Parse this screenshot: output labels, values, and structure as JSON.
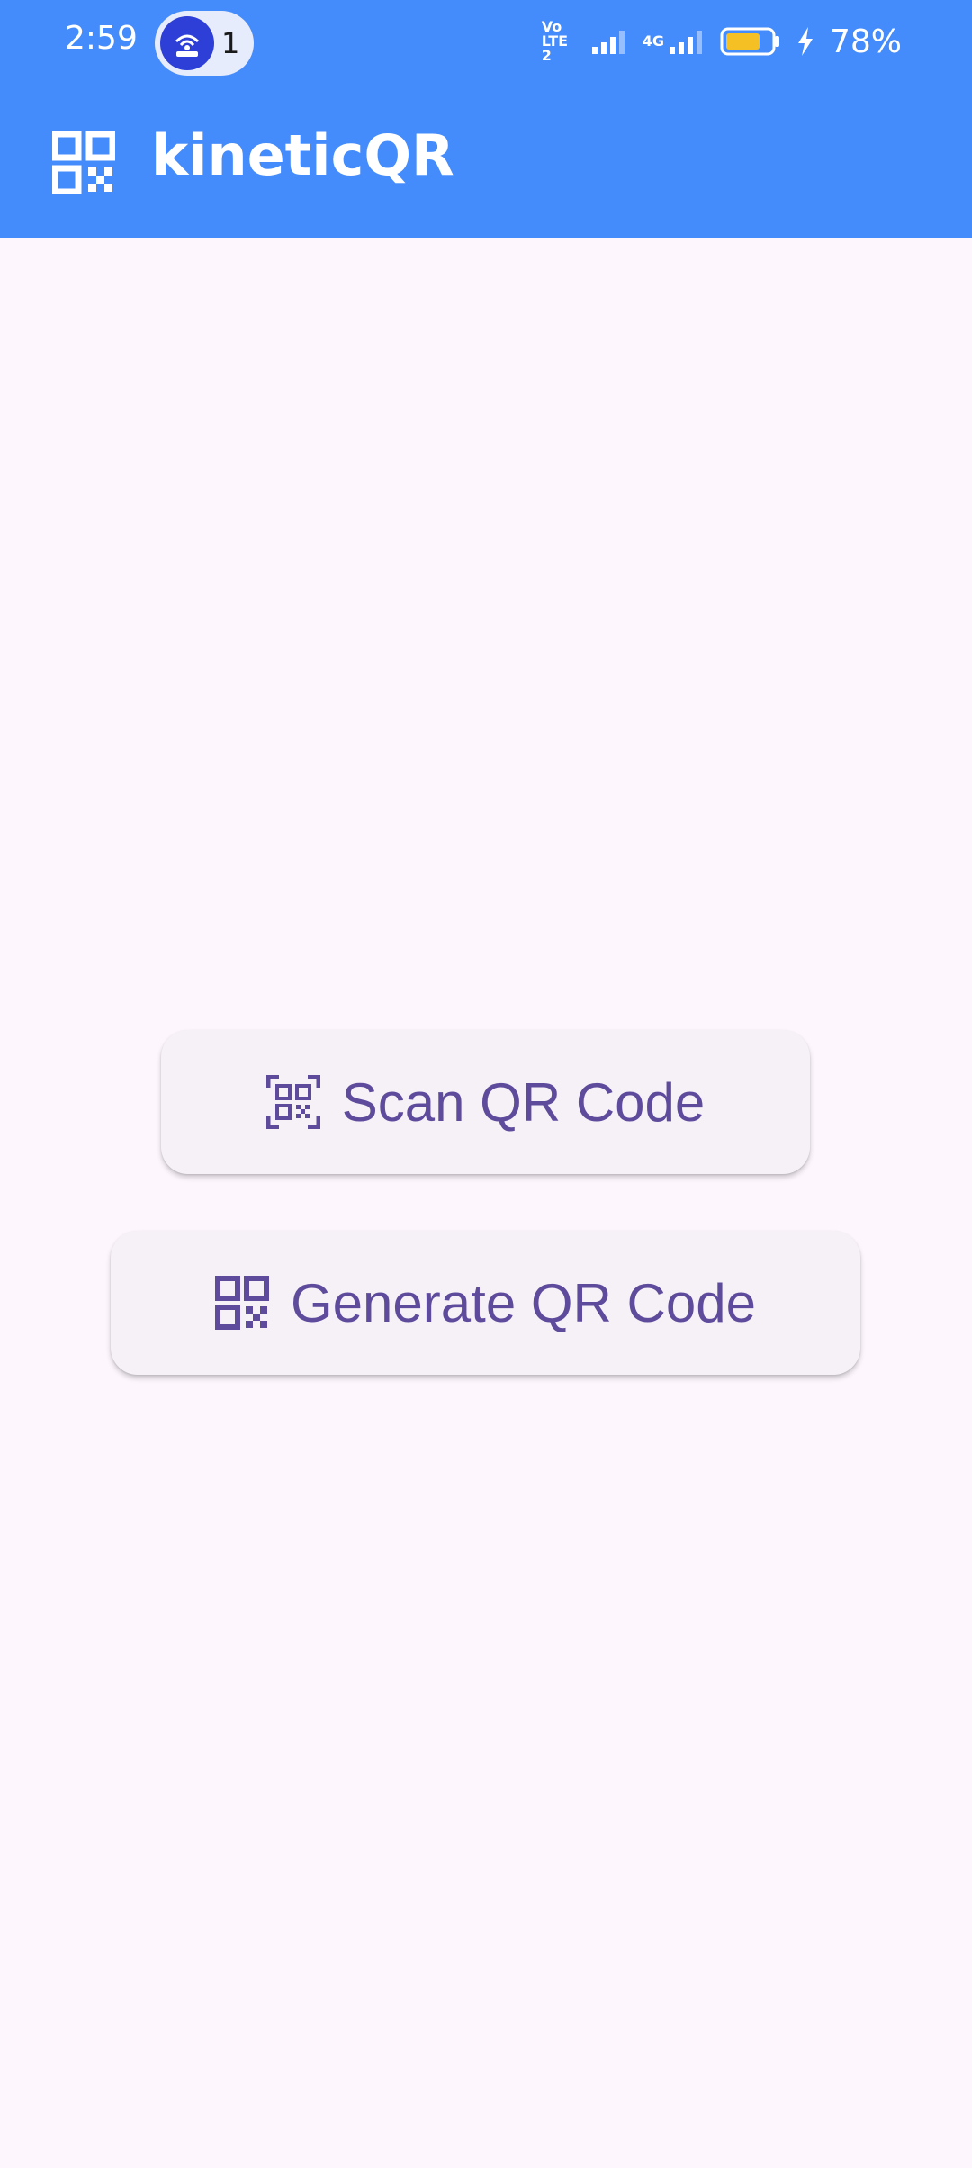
{
  "colors": {
    "app_bar": "#448bfc",
    "background": "#fdf7fd",
    "button_bg": "#f5f1f7",
    "accent": "#5f4b9c",
    "white": "#ffffff"
  },
  "status_bar": {
    "time": "2:59",
    "hotspot_count": "1",
    "volte_label": "Vo LTE2",
    "network_label": "4G",
    "battery_percent": "78%",
    "battery_level": 0.78,
    "icons": [
      "hotspot-icon",
      "volte-icon",
      "signal-icon",
      "signal-4g-icon",
      "battery-icon",
      "charging-icon"
    ]
  },
  "app_bar": {
    "title": "kineticQR",
    "icon": "qr-code-icon"
  },
  "main": {
    "scan_button": {
      "label": "Scan QR Code",
      "icon": "qr-scan-icon"
    },
    "generate_button": {
      "label": "Generate QR Code",
      "icon": "qr-code-icon"
    }
  }
}
